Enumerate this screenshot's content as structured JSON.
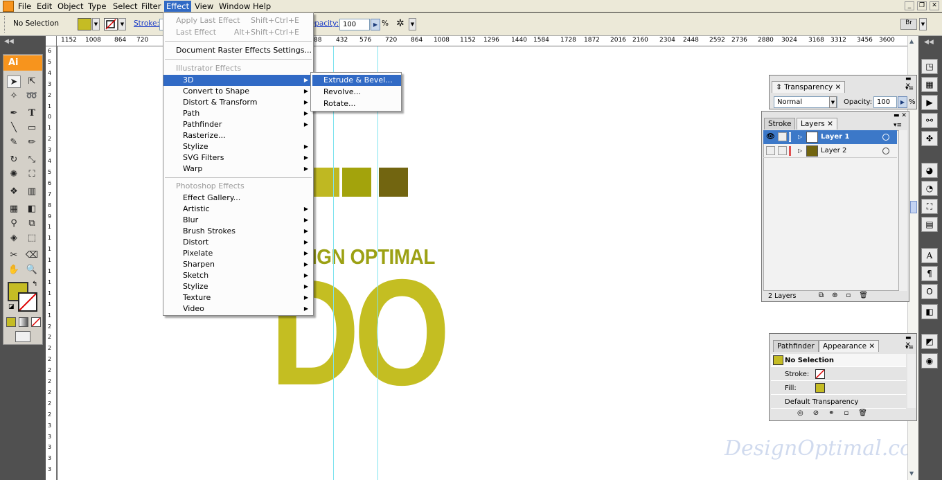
{
  "menubar": {
    "items": [
      "File",
      "Edit",
      "Object",
      "Type",
      "Select",
      "Filter",
      "Effect",
      "View",
      "Window",
      "Help"
    ]
  },
  "controlbar": {
    "selection_status": "No Selection",
    "stroke_label": "Stroke:",
    "opacity_label": "Opacity:",
    "opacity_value": "100",
    "percent": "%"
  },
  "colors": {
    "fill": "#c5bc24",
    "square1": "#bfb822",
    "square2": "#a3a30c",
    "square3": "#726510",
    "title_text": "#9ca114",
    "big_text": "#c4be22",
    "guide": "#7ee3ef",
    "highlight": "#316ac5"
  },
  "ruler": {
    "h_labels": [
      "1152",
      "1008",
      "864",
      "720",
      "88",
      "432",
      "576",
      "720",
      "864",
      "1008",
      "1152",
      "1296",
      "1440",
      "1584",
      "1728",
      "1872",
      "2016",
      "2160",
      "2304",
      "2448",
      "2592",
      "2736",
      "2880",
      "3024",
      "3168",
      "3312",
      "3456",
      "3600"
    ],
    "v_labels": [
      "6",
      "5",
      "4",
      "3",
      "2",
      "1",
      "0",
      "1",
      "2",
      "3",
      "4",
      "5",
      "6",
      "7",
      "8",
      "9",
      "1",
      "1",
      "1",
      "1",
      "1",
      "1",
      "1",
      "1",
      "1",
      "2",
      "2",
      "2",
      "2",
      "2",
      "2",
      "2",
      "2",
      "2",
      "3",
      "3",
      "3",
      "3",
      "3"
    ]
  },
  "toolbox": {
    "logo": "Ai"
  },
  "artwork": {
    "title_text": "IGN OPTIMAL",
    "big_text": "DO",
    "watermark": "DesignOptimal.com"
  },
  "effect_menu": {
    "apply_last": {
      "label": "Apply Last Effect",
      "shortcut": "Shift+Ctrl+E"
    },
    "last_effect": {
      "label": "Last Effect",
      "shortcut": "Alt+Shift+Ctrl+E"
    },
    "raster_settings": "Document Raster Effects Settings...",
    "illustrator_header": "Illustrator Effects",
    "illustrator_items": [
      "3D",
      "Convert to Shape",
      "Distort & Transform",
      "Path",
      "Pathfinder",
      "Rasterize...",
      "Stylize",
      "SVG Filters",
      "Warp"
    ],
    "photoshop_header": "Photoshop Effects",
    "photoshop_items": [
      "Effect Gallery...",
      "Artistic",
      "Blur",
      "Brush Strokes",
      "Distort",
      "Pixelate",
      "Sharpen",
      "Sketch",
      "Stylize",
      "Texture",
      "Video"
    ]
  },
  "submenu_3d": {
    "items": [
      "Extrude & Bevel...",
      "Revolve...",
      "Rotate..."
    ]
  },
  "transparency_panel": {
    "tab": "Transparency",
    "blend_mode": "Normal",
    "opacity_label": "Opacity:",
    "opacity_value": "100",
    "percent": "%"
  },
  "layers_panel": {
    "tabs": [
      "Stroke",
      "Layers"
    ],
    "layers": [
      {
        "name": "Layer 1",
        "selected": true,
        "color": "#3c78c8"
      },
      {
        "name": "Layer 2",
        "selected": false,
        "color": "#e05050"
      }
    ],
    "footer": "2 Layers"
  },
  "appearance_panel": {
    "tabs": [
      "Pathfinder",
      "Appearance"
    ],
    "title": "No Selection",
    "stroke_label": "Stroke:",
    "fill_label": "Fill:",
    "transparency_label": "Default Transparency"
  }
}
